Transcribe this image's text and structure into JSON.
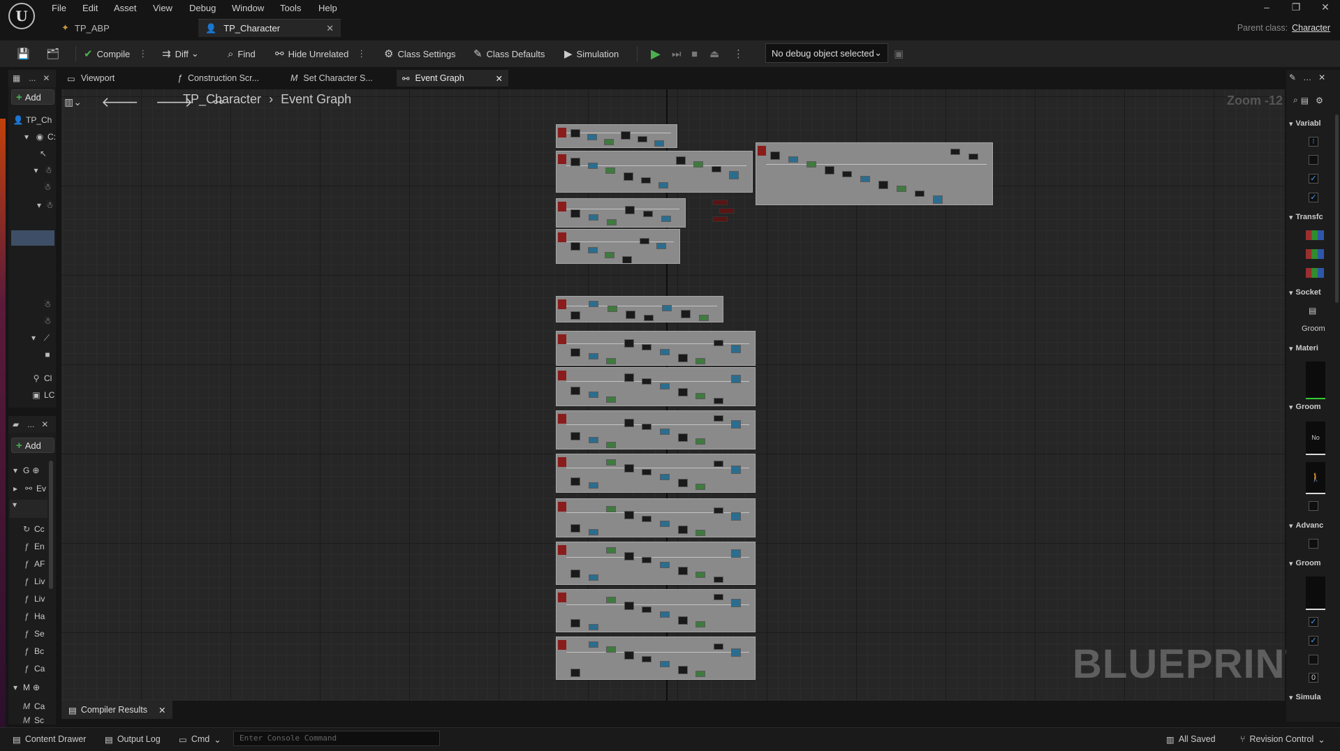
{
  "menu": [
    "File",
    "Edit",
    "Asset",
    "View",
    "Debug",
    "Window",
    "Tools",
    "Help"
  ],
  "doc_tabs": [
    {
      "label": "TP_ABP",
      "active": false
    },
    {
      "label": "TP_Character",
      "active": true
    }
  ],
  "parent_class": {
    "label": "Parent class:",
    "value": "Character"
  },
  "toolbar": {
    "compile": "Compile",
    "diff": "Diff",
    "find": "Find",
    "hide_unrelated": "Hide Unrelated",
    "class_settings": "Class Settings",
    "class_defaults": "Class Defaults",
    "simulation": "Simulation",
    "debug_select": "No debug object selected"
  },
  "graph_tabs": [
    "Viewport",
    "Construction Scr...",
    "Set Character S...",
    "Event Graph"
  ],
  "breadcrumb": {
    "root": "TP_Character",
    "current": "Event Graph"
  },
  "zoom": "Zoom -12",
  "watermark": "BLUEPRINT",
  "components_panel": {
    "title": "...",
    "add": "Add",
    "rows": [
      "TP_Ch",
      "C:",
      "",
      "",
      "",
      "",
      "",
      "",
      "",
      "",
      "",
      "Cl",
      "LC"
    ]
  },
  "mybp_panel": {
    "title": "...",
    "add": "Add",
    "rows": [
      {
        "icon": "G",
        "label": ""
      },
      {
        "icon": "graph",
        "label": "Ev"
      },
      {
        "icon": "",
        "label": ""
      },
      {
        "icon": "f",
        "label": "Cc"
      },
      {
        "icon": "f",
        "label": "En"
      },
      {
        "icon": "f",
        "label": "AF"
      },
      {
        "icon": "f",
        "label": "Liv"
      },
      {
        "icon": "f",
        "label": "Liv"
      },
      {
        "icon": "f",
        "label": "Ha"
      },
      {
        "icon": "f",
        "label": "Se"
      },
      {
        "icon": "f",
        "label": "Bc"
      },
      {
        "icon": "f",
        "label": "Ca"
      },
      {
        "icon": "M",
        "label": ""
      },
      {
        "icon": "M",
        "label": "Ca"
      },
      {
        "icon": "M",
        "label": "Sc"
      }
    ]
  },
  "details": {
    "sections": [
      "Variabl",
      "Transfc",
      "Socket",
      "Groom",
      "Materi",
      "Groom",
      "Advanc",
      "Groom",
      "Simula"
    ],
    "no_label": "No",
    "zero": "0"
  },
  "compiler_tab": "Compiler Results",
  "status": {
    "content_drawer": "Content Drawer",
    "output_log": "Output Log",
    "cmd": "Cmd",
    "console_placeholder": "Enter Console Command",
    "all_saved": "All Saved",
    "revision_control": "Revision Control"
  }
}
